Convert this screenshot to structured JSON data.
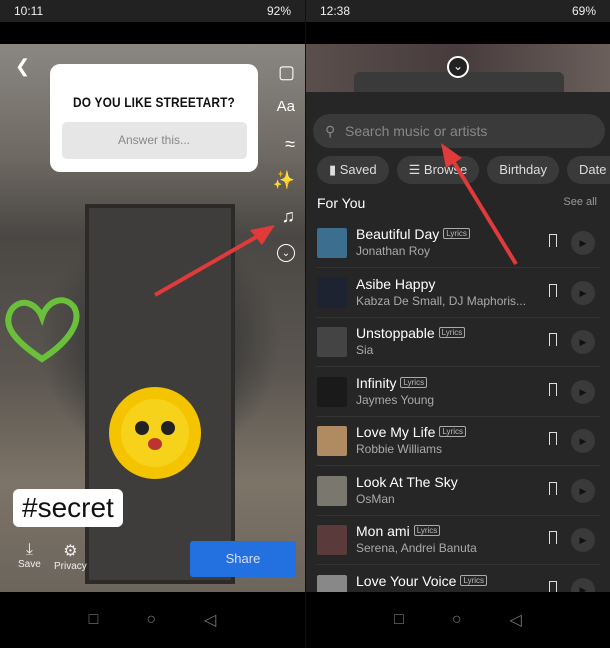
{
  "left": {
    "status": {
      "time": "10:11",
      "battery": "92%"
    },
    "question": {
      "title": "DO YOU LIKE STREETART?",
      "placeholder": "Answer this..."
    },
    "hashtag": "#secret",
    "tools": [
      "sticker-icon",
      "text-icon",
      "draw-icon",
      "effects-icon",
      "music-icon"
    ],
    "text_tool": "Aa",
    "save_label": "Save",
    "privacy_label": "Privacy",
    "share_label": "Share"
  },
  "right": {
    "status": {
      "time": "12:38",
      "battery": "69%"
    },
    "search_placeholder": "Search music or artists",
    "chips": [
      "Saved",
      "Browse",
      "Birthday",
      "Date Nig"
    ],
    "section_title": "For You",
    "see_all": "See all",
    "lyrics_badge": "Lyrics",
    "tracks": [
      {
        "title": "Beautiful Day",
        "artist": "Jonathan Roy",
        "lyrics": true,
        "thumb": "#3c6e8f"
      },
      {
        "title": "Asibe Happy",
        "artist": "Kabza De Small, DJ Maphoris...",
        "lyrics": false,
        "thumb": "#1d2330"
      },
      {
        "title": "Unstoppable",
        "artist": "Sia",
        "lyrics": true,
        "thumb": "#444"
      },
      {
        "title": "Infinity",
        "artist": "Jaymes Young",
        "lyrics": true,
        "thumb": "#1a1a1a"
      },
      {
        "title": "Love My Life",
        "artist": "Robbie Williams",
        "lyrics": true,
        "thumb": "#b08a60"
      },
      {
        "title": "Look At The Sky",
        "artist": "OsMan",
        "lyrics": false,
        "thumb": "#7a776f"
      },
      {
        "title": "Mon ami",
        "artist": "Serena, Andrei Banuta",
        "lyrics": true,
        "thumb": "#5a3a3a"
      },
      {
        "title": "Love Your Voice",
        "artist": "",
        "lyrics": true,
        "thumb": "#888"
      }
    ]
  },
  "colors": {
    "share": "#2371e0",
    "sheet": "#262626",
    "arrow": "#e03a3a"
  }
}
